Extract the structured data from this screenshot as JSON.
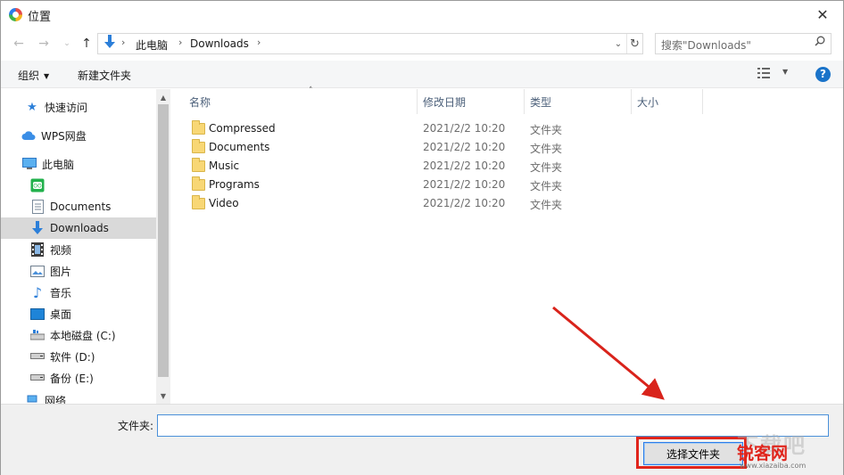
{
  "window": {
    "title": "位置",
    "close_glyph": "✕"
  },
  "addressbar": {
    "crumbs": [
      "此电脑",
      "Downloads"
    ],
    "separator": "›",
    "dropdown_glyph": "⌄",
    "refresh_glyph": "↻"
  },
  "search": {
    "placeholder": "搜索\"Downloads\"",
    "icon": "search-icon"
  },
  "toolbar": {
    "organize_label": "组织",
    "new_folder_label": "新建文件夹",
    "help_label": "?"
  },
  "sidebar": {
    "items": [
      {
        "label": "快速访问",
        "icon": "star-icon"
      },
      {
        "label": "WPS网盘",
        "icon": "cloud-icon"
      },
      {
        "label": "此电脑",
        "icon": "pc-icon"
      },
      {
        "label": "",
        "icon": "app-green-icon"
      },
      {
        "label": "Documents",
        "icon": "document-icon"
      },
      {
        "label": "Downloads",
        "icon": "download-icon",
        "selected": true
      },
      {
        "label": "视频",
        "icon": "video-icon"
      },
      {
        "label": "图片",
        "icon": "picture-icon"
      },
      {
        "label": "音乐",
        "icon": "music-icon"
      },
      {
        "label": "桌面",
        "icon": "desktop-icon"
      },
      {
        "label": "本地磁盘 (C:)",
        "icon": "drive-icon"
      },
      {
        "label": "软件 (D:)",
        "icon": "drive-icon"
      },
      {
        "label": "备份 (E:)",
        "icon": "drive-icon"
      },
      {
        "label": "网络",
        "icon": "network-icon"
      }
    ]
  },
  "filelist": {
    "columns": [
      "名称",
      "修改日期",
      "类型",
      "大小"
    ],
    "rows": [
      {
        "name": "Compressed",
        "date": "2021/2/2 10:20",
        "type": "文件夹"
      },
      {
        "name": "Documents",
        "date": "2021/2/2 10:20",
        "type": "文件夹"
      },
      {
        "name": "Music",
        "date": "2021/2/2 10:20",
        "type": "文件夹"
      },
      {
        "name": "Programs",
        "date": "2021/2/2 10:20",
        "type": "文件夹"
      },
      {
        "name": "Video",
        "date": "2021/2/2 10:20",
        "type": "文件夹"
      }
    ]
  },
  "bottom": {
    "folder_label": "文件夹:",
    "folder_value": "",
    "select_button": "选择文件夹"
  },
  "annotation": {
    "color": "#e0251c"
  },
  "watermark": {
    "chars": "下载吧",
    "brand": "锐客网",
    "url": "www.xiazaiba.com"
  }
}
